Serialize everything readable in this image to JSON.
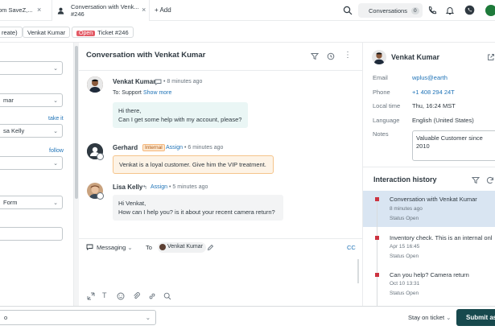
{
  "tabs": [
    {
      "label": "om SaveZ,..."
    },
    {
      "line1": "Conversation with Venk...",
      "line2": "#246"
    }
  ],
  "add_tab_label": "+ Add",
  "conversations_button": {
    "label": "Conversations",
    "count": "0"
  },
  "breadcrumb": {
    "requester": "reate)",
    "assignee": "Venkat Kumar",
    "status": "Open",
    "ticket": "Ticket #246"
  },
  "left_panel": {
    "field1_value": "",
    "field2_value": "mar",
    "take_it": "take it",
    "field3_value": "sa Kelly",
    "follow": "follow",
    "field4_value": "",
    "field5_value": "Form",
    "field6_value": ""
  },
  "conversation": {
    "title": "Conversation with Venkat Kumar",
    "messages": [
      {
        "author": "Venkat Kumar",
        "time": "8 minutes ago",
        "to_label": "To:",
        "to_value": "Support",
        "show_more": "Show more",
        "text_line1": "Hi there,",
        "text_line2": "Can I get some help with my account, please?"
      },
      {
        "author": "Gerhard",
        "badge": "Internal",
        "assign": "Assign",
        "time": "6 minutes ago",
        "text_line1": "Venkat is a loyal customer. Give him the VIP treatment."
      },
      {
        "author": "Lisa Kelly",
        "assign": "Assign",
        "time": "5 minutes ago",
        "text_line1": "Hi Venkat,",
        "text_line2": "How can I help you? is it about your recent camera return?"
      }
    ]
  },
  "composer": {
    "channel": "Messaging",
    "to_label": "To",
    "to_value": "Venkat Kumar",
    "cc_label": "CC"
  },
  "customer": {
    "name": "Venkat Kumar",
    "email_label": "Email",
    "email": "wplus@earth",
    "phone_label": "Phone",
    "phone": "+1 408 294 24T",
    "local_time_label": "Local time",
    "local_time": "Thu, 16:24 MST",
    "language_label": "Language",
    "language": "English (United States)",
    "notes_label": "Notes",
    "notes": "Valuable Customer since 2010"
  },
  "interaction_history": {
    "title": "Interaction history",
    "items": [
      {
        "title": "Conversation with Venkat Kumar",
        "time": "8 minutes ago",
        "status": "Status Open"
      },
      {
        "title": "Inventory check. This is an internal onl",
        "time": "Apr 15 16:45",
        "status": "Status Open"
      },
      {
        "title": "Can you help? Camera return",
        "time": "Oct 10 13:31",
        "status": "Status Open"
      }
    ]
  },
  "footer": {
    "macro_value": "o",
    "stay_label": "Stay on ticket",
    "submit_label": "Submit as"
  },
  "colors": {
    "accent": "#17494d",
    "link": "#1f73b7",
    "danger": "#cc3340",
    "internal_bg": "#fdf3e6"
  }
}
